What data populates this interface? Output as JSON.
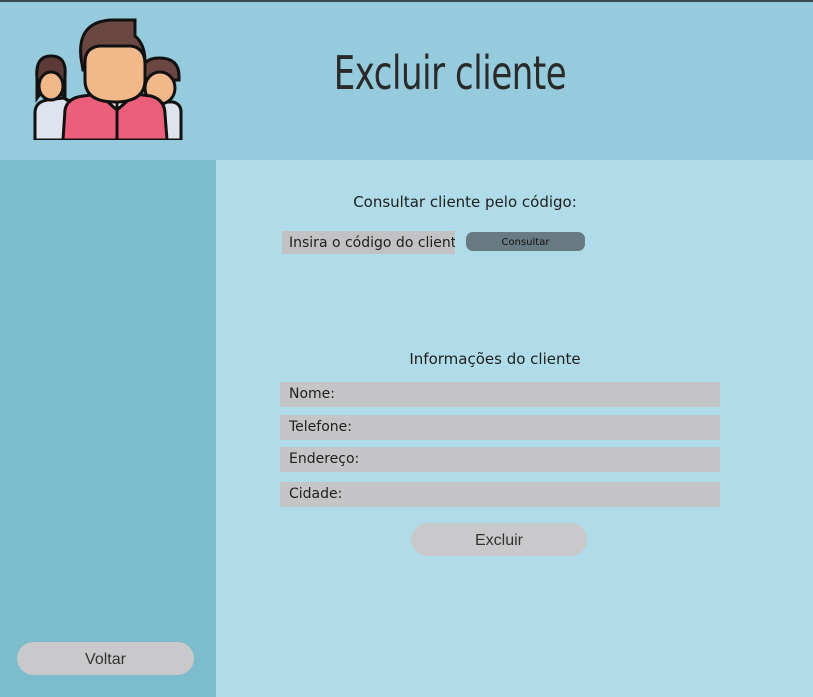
{
  "header": {
    "title": "Excluir cliente"
  },
  "search": {
    "heading": "Consultar cliente pelo código:",
    "placeholder": "Insira o código do cliente",
    "button_label": "Consultar"
  },
  "info": {
    "heading": "Informações do cliente",
    "fields": [
      {
        "label": "Nome:"
      },
      {
        "label": "Telefone:"
      },
      {
        "label": "Endereço:"
      },
      {
        "label": "Cidade:"
      }
    ]
  },
  "actions": {
    "delete_label": "Excluir",
    "back_label": "Voltar"
  },
  "colors": {
    "header_bg": "#95cbdd",
    "sidebar_bg": "#7cbccd",
    "main_bg": "#b0dcea",
    "field_bg": "#c5c5c7",
    "consult_button_bg": "#687a82"
  }
}
